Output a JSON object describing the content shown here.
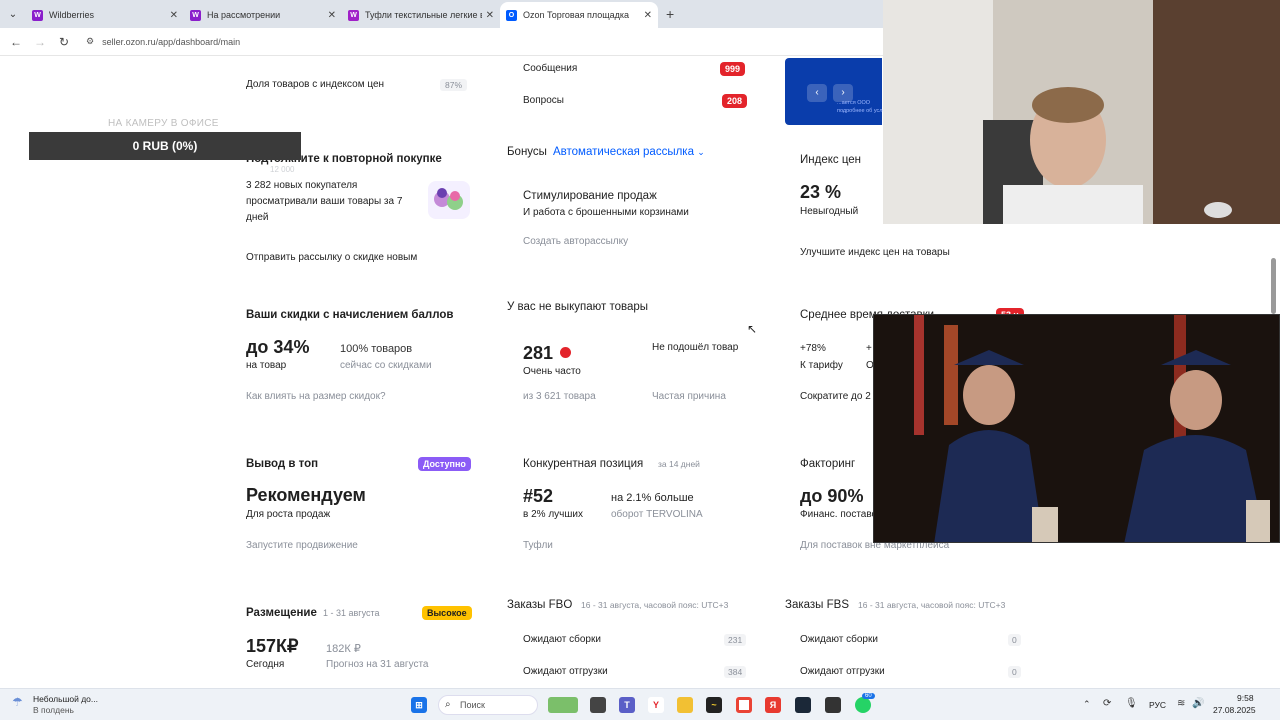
{
  "browser": {
    "tabs": [
      {
        "title": "Wildberries",
        "active": false,
        "favicon_color": "#8a1ecb",
        "favicon_letter": "W"
      },
      {
        "title": "На рассмотрении",
        "active": false,
        "favicon_color": "#8a1ecb",
        "favicon_letter": "W"
      },
      {
        "title": "Туфли текстильные легкие в с",
        "active": false,
        "favicon_color": "#a020c8",
        "favicon_letter": "W"
      },
      {
        "title": "Ozon Торговая площадка",
        "active": true,
        "favicon_color": "#005bff",
        "favicon_letter": "O"
      }
    ],
    "url": "seller.ozon.ru/app/dashboard/main"
  },
  "overlay": {
    "caption": "НА КАМЕРУ В ОФИСЕ",
    "bar_text": "0 RUB (0%)"
  },
  "col1": {
    "price_index_share": {
      "label": "Доля товаров с индексом цен",
      "value": "87%"
    },
    "repeat": {
      "title": "Подтолкните к повторной покупке",
      "hidden_number": "12 000",
      "text1": "3 282 новых покупателя",
      "text2": "просматривали ваши товары за 7",
      "text3": "дней",
      "action": "Отправить рассылку о скидке новым"
    },
    "discounts": {
      "title": "Ваши скидки с начислением баллов",
      "big": "до 34%",
      "big_sub": "на товар",
      "right_val": "100% товаров",
      "right_sub": "сейчас со скидками",
      "link": "Как влиять на размер скидок?"
    },
    "top": {
      "title": "Вывод в топ",
      "badge": "Доступно",
      "badge_color": "#8b5cf6",
      "big": "Рекомендуем",
      "sub": "Для роста продаж",
      "link": "Запустите продвижение"
    },
    "placement": {
      "title": "Размещение",
      "period": "1 - 31 августа",
      "badge": "Высокое",
      "badge_color": "#ffc200",
      "big": "157К₽",
      "big_sub": "Сегодня",
      "right_val": "182К ₽",
      "right_sub": "Прогноз на 31 августа"
    }
  },
  "col2": {
    "messages": {
      "label": "Сообщения",
      "count": "999"
    },
    "questions": {
      "label": "Вопросы",
      "count": "208"
    },
    "bonuses": {
      "title": "Бонусы",
      "dropdown": "Автоматическая рассылка",
      "card_title": "Стимулирование продаж",
      "card_sub": "И работа с брошенными корзинами",
      "link": "Создать авторассылку"
    },
    "not_bought": {
      "title": "У вас не выкупают товары",
      "value": "281",
      "value_sub": "Очень часто",
      "of": "из 3 621 товара",
      "reason": "Не подошёл товар",
      "reason_sub": "Частая причина"
    },
    "competitive": {
      "title": "Конкурентная позиция",
      "period": "за 14 дней",
      "big": "#52",
      "big_sub": "в 2% лучших",
      "right_val": "на 2.1% больше",
      "right_sub": "оборот TERVOLINA",
      "link": "Туфли"
    },
    "fbo": {
      "title": "Заказы FBO",
      "period": "16 - 31 августа, часовой пояс: UTC+3",
      "rows": [
        {
          "label": "Ожидают сборки",
          "count": "231"
        },
        {
          "label": "Ожидают отгрузки",
          "count": "384"
        }
      ]
    }
  },
  "col3": {
    "price_index": {
      "title": "Индекс цен",
      "big": "23 %",
      "sub": "Невыгодный",
      "link": "Улучшите индекс цен на товары"
    },
    "avg_time": {
      "title": "Среднее время доставки",
      "badge": "53 ч",
      "val": "+78%",
      "val_sub": "К тарифу",
      "val2": "+",
      "val2_sub": "О",
      "link": "Сократите до 2"
    },
    "factoring": {
      "title": "Факторинг",
      "big": "до 90%",
      "sub": "Финанс. поставок",
      "link": "Для поставок вне маркетплейса"
    },
    "fbs": {
      "title": "Заказы FBS",
      "period": "16 - 31 августа, часовой пояс: UTC+3",
      "rows": [
        {
          "label": "Ожидают сборки",
          "count": "0"
        },
        {
          "label": "Ожидают отгрузки",
          "count": "0"
        }
      ]
    }
  },
  "banner": {
    "text1": "...ается OOO",
    "text2": "подробнее об условиях и тут"
  },
  "taskbar": {
    "weather_title": "Небольшой до...",
    "weather_sub": "В полдень",
    "search": "Поиск",
    "lang": "РУС",
    "time": "9:58",
    "date": "27.08.2025",
    "notif_badge": "60"
  }
}
